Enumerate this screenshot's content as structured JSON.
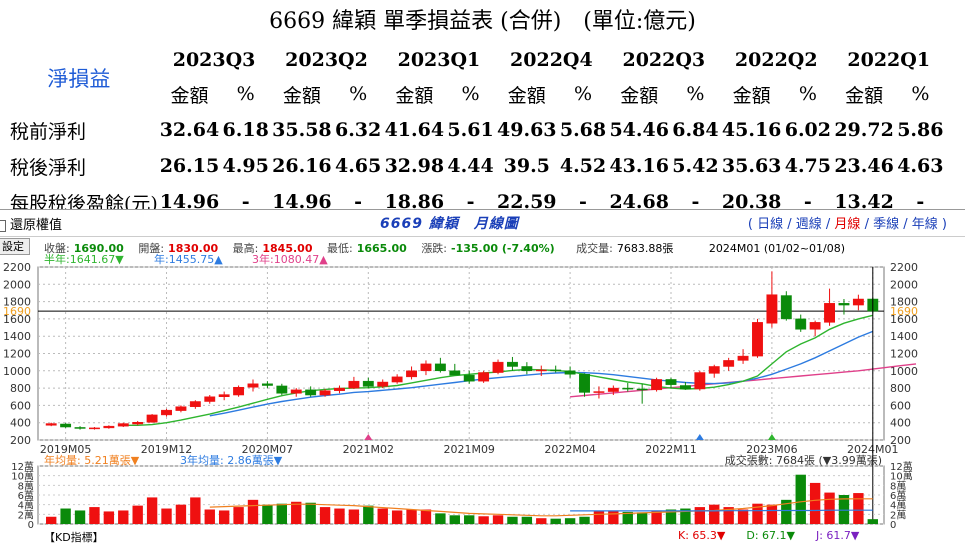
{
  "title": "6669 緯穎 單季損益表 (合併)　(單位:億元)",
  "table": {
    "net_label": "淨損益",
    "quarters": [
      "2023Q3",
      "2023Q2",
      "2023Q1",
      "2022Q4",
      "2022Q3",
      "2022Q2",
      "2022Q1"
    ],
    "amount_label": "金額",
    "pct_label": "%",
    "rows": [
      {
        "label": "稅前淨利",
        "cells": [
          [
            "32.64",
            "6.18"
          ],
          [
            "35.58",
            "6.32"
          ],
          [
            "41.64",
            "5.61"
          ],
          [
            "49.63",
            "5.68"
          ],
          [
            "54.46",
            "6.84"
          ],
          [
            "45.16",
            "6.02"
          ],
          [
            "29.72",
            "5.86"
          ]
        ]
      },
      {
        "label": "稅後淨利",
        "cells": [
          [
            "26.15",
            "4.95"
          ],
          [
            "26.16",
            "4.65"
          ],
          [
            "32.98",
            "4.44"
          ],
          [
            "39.5",
            "4.52"
          ],
          [
            "43.16",
            "5.42"
          ],
          [
            "35.63",
            "4.75"
          ],
          [
            "23.46",
            "4.63"
          ]
        ]
      },
      {
        "label": "每股稅後盈餘(元)",
        "cells": [
          [
            "14.96",
            "-"
          ],
          [
            "14.96",
            "-"
          ],
          [
            "18.86",
            "-"
          ],
          [
            "22.59",
            "-"
          ],
          [
            "24.68",
            "-"
          ],
          [
            "20.38",
            "-"
          ],
          [
            "13.42",
            "-"
          ]
        ]
      }
    ]
  },
  "chart_header": {
    "restore_label": "還原權值",
    "chart_name": "6669 緯穎　月線圖",
    "periods": [
      "日線",
      "週線",
      "月線",
      "季線",
      "年線"
    ],
    "active_period": "月線"
  },
  "quote": {
    "settings_label": "設定",
    "close_label": "收盤:",
    "close": "1690.00",
    "open_label": "開盤:",
    "open": "1830.00",
    "high_label": "最高:",
    "high": "1845.00",
    "low_label": "最低:",
    "low": "1665.00",
    "change_label": "漲跌:",
    "change": "-135.00 (-7.40%)",
    "volume_label": "成交量:",
    "volume": "7683.88張",
    "period_range": "2024M01 (01/02~01/08)"
  },
  "ma_legend": {
    "half_year": "半年:1641.67▼",
    "year": "年:1455.75▲",
    "three_year": "3年:1080.47▲"
  },
  "volume_legend": {
    "year_avg": "年均量: 5.21萬張▼",
    "three_year_avg": "3年均量: 2.86萬張▼",
    "count": "成交張數: 7684張 (▼3.99萬張)"
  },
  "kd": {
    "label": "【KD指標】",
    "k": "K: 65.3▼",
    "d": "D: 67.1▼",
    "j": "J: 61.7▼"
  },
  "colors": {
    "up": "#ef1010",
    "down": "#0a8a0a",
    "ma_half": "#2fb52f",
    "ma_year": "#2d7be0",
    "ma_3year": "#e0408a",
    "link": "#1a3fb8",
    "price_line": "#f0a020"
  },
  "chart_data": {
    "type": "candlestick",
    "y_ticks": [
      200,
      400,
      600,
      800,
      1000,
      1200,
      1400,
      1600,
      1800,
      2000,
      2200
    ],
    "ylim": [
      200,
      2200
    ],
    "price_marker": "1690",
    "x_tick_labels": [
      {
        "i": 1,
        "label": "2019M05"
      },
      {
        "i": 8,
        "label": "2019M12"
      },
      {
        "i": 15,
        "label": "2020M07"
      },
      {
        "i": 22,
        "label": "2021M02"
      },
      {
        "i": 29,
        "label": "2021M09"
      },
      {
        "i": 36,
        "label": "2022M04"
      },
      {
        "i": 43,
        "label": "2022M11"
      },
      {
        "i": 50,
        "label": "2023M06"
      },
      {
        "i": 57,
        "label": "2024M01"
      }
    ],
    "event_markers": [
      {
        "i": 22,
        "color": "#e0408a"
      },
      {
        "i": 45,
        "color": "#2d7be0"
      },
      {
        "i": 50,
        "color": "#2fb52f"
      }
    ],
    "ohlc": [
      [
        370,
        400,
        360,
        390
      ],
      [
        385,
        395,
        340,
        350
      ],
      [
        345,
        360,
        320,
        335
      ],
      [
        335,
        350,
        320,
        340
      ],
      [
        340,
        370,
        330,
        360
      ],
      [
        360,
        400,
        350,
        390
      ],
      [
        385,
        420,
        370,
        405
      ],
      [
        405,
        500,
        400,
        490
      ],
      [
        490,
        560,
        470,
        545
      ],
      [
        540,
        600,
        520,
        585
      ],
      [
        585,
        660,
        560,
        645
      ],
      [
        645,
        720,
        620,
        700
      ],
      [
        700,
        760,
        660,
        725
      ],
      [
        720,
        830,
        700,
        810
      ],
      [
        810,
        900,
        760,
        850
      ],
      [
        850,
        880,
        800,
        830
      ],
      [
        825,
        850,
        720,
        740
      ],
      [
        740,
        800,
        700,
        780
      ],
      [
        780,
        820,
        700,
        720
      ],
      [
        720,
        790,
        700,
        770
      ],
      [
        770,
        830,
        740,
        800
      ],
      [
        800,
        930,
        790,
        880
      ],
      [
        880,
        920,
        800,
        820
      ],
      [
        820,
        900,
        800,
        870
      ],
      [
        870,
        960,
        850,
        930
      ],
      [
        930,
        1050,
        900,
        1000
      ],
      [
        1000,
        1120,
        950,
        1080
      ],
      [
        1080,
        1150,
        980,
        1000
      ],
      [
        1000,
        1080,
        950,
        950
      ],
      [
        950,
        1000,
        850,
        880
      ],
      [
        880,
        1000,
        860,
        980
      ],
      [
        980,
        1130,
        960,
        1100
      ],
      [
        1100,
        1160,
        1000,
        1050
      ],
      [
        1050,
        1100,
        960,
        1000
      ],
      [
        1000,
        1060,
        940,
        1010
      ],
      [
        1010,
        1060,
        980,
        1000
      ],
      [
        1000,
        1050,
        920,
        960
      ],
      [
        960,
        970,
        700,
        750
      ],
      [
        750,
        820,
        680,
        760
      ],
      [
        760,
        830,
        720,
        800
      ],
      [
        800,
        860,
        760,
        790
      ],
      [
        790,
        850,
        620,
        780
      ],
      [
        780,
        920,
        760,
        900
      ],
      [
        900,
        920,
        800,
        840
      ],
      [
        830,
        870,
        780,
        790
      ],
      [
        790,
        1000,
        770,
        980
      ],
      [
        970,
        1070,
        920,
        1050
      ],
      [
        1050,
        1150,
        1000,
        1120
      ],
      [
        1120,
        1250,
        1080,
        1170
      ],
      [
        1170,
        1600,
        1150,
        1560
      ],
      [
        1550,
        2150,
        1500,
        1880
      ],
      [
        1870,
        1920,
        1580,
        1600
      ],
      [
        1600,
        1650,
        1450,
        1480
      ],
      [
        1480,
        1580,
        1400,
        1560
      ],
      [
        1560,
        1950,
        1520,
        1780
      ],
      [
        1780,
        1830,
        1650,
        1760
      ],
      [
        1760,
        1880,
        1700,
        1830
      ],
      [
        1830,
        1845,
        1665,
        1690
      ]
    ],
    "ma_half": [
      null,
      null,
      null,
      null,
      null,
      370,
      370,
      378,
      400,
      430,
      465,
      500,
      540,
      580,
      625,
      670,
      712,
      745,
      770,
      785,
      795,
      800,
      805,
      815,
      830,
      860,
      890,
      920,
      945,
      960,
      975,
      985,
      1005,
      1015,
      1012,
      1005,
      990,
      960,
      930,
      900,
      870,
      850,
      820,
      800,
      790,
      795,
      810,
      840,
      880,
      940,
      1080,
      1220,
      1310,
      1380,
      1480,
      1550,
      1600,
      1641.67
    ],
    "ma_year": [
      null,
      null,
      null,
      null,
      null,
      null,
      null,
      null,
      null,
      null,
      null,
      480,
      510,
      545,
      580,
      615,
      645,
      670,
      695,
      715,
      730,
      750,
      760,
      775,
      790,
      805,
      825,
      845,
      865,
      885,
      905,
      920,
      935,
      950,
      965,
      975,
      980,
      978,
      970,
      955,
      935,
      915,
      895,
      880,
      865,
      855,
      852,
      860,
      880,
      915,
      960,
      1020,
      1080,
      1150,
      1230,
      1310,
      1390,
      1455.75
    ],
    "ma_3year": [
      null,
      null,
      null,
      null,
      null,
      null,
      null,
      null,
      null,
      null,
      null,
      null,
      null,
      null,
      null,
      null,
      null,
      null,
      null,
      null,
      null,
      null,
      null,
      null,
      null,
      null,
      null,
      null,
      null,
      null,
      null,
      null,
      null,
      null,
      null,
      null,
      null,
      null,
      null,
      null,
      null,
      null,
      null,
      null,
      null,
      null,
      null,
      null,
      null,
      null,
      null,
      null,
      null,
      null,
      null,
      null,
      null,
      null,
      null,
      null,
      null,
      null,
      null,
      null,
      null,
      null,
      null,
      null,
      null,
      null,
      null,
      null,
      null,
      null,
      null,
      null,
      null,
      null,
      null,
      null,
      null,
      null,
      null,
      null,
      null,
      null,
      null,
      null,
      null,
      null,
      null,
      null,
      null,
      null
    ],
    "ma_3year_from": 36,
    "ma_3year_values": [
      700,
      715,
      730,
      745,
      760,
      775,
      790,
      805,
      820,
      835,
      850,
      865,
      880,
      895,
      910,
      925,
      940,
      955,
      970,
      985,
      1000,
      1020,
      1040,
      1060,
      1080
    ],
    "ma_3year_start_index": 36,
    "volume_ticks": [
      0,
      2,
      4,
      6,
      8,
      10,
      12
    ],
    "volume_unit": "萬",
    "volume_ylim": [
      0,
      12
    ],
    "volume": [
      1.5,
      3.2,
      2.8,
      3.5,
      2.6,
      2.8,
      3.8,
      5.5,
      3.2,
      4.0,
      5.5,
      3.0,
      2.8,
      3.5,
      5.0,
      4.0,
      4.2,
      4.6,
      4.4,
      3.5,
      3.2,
      3.0,
      3.8,
      3.2,
      2.8,
      3.0,
      3.0,
      2.2,
      1.8,
      1.8,
      1.6,
      1.8,
      1.5,
      1.5,
      1.2,
      1.1,
      1.2,
      1.5,
      2.6,
      2.8,
      2.5,
      2.4,
      2.8,
      3.0,
      3.2,
      3.5,
      4.0,
      3.5,
      3.0,
      4.2,
      4.0,
      5.0,
      10.2,
      8.5,
      6.5,
      6.0,
      6.4,
      1.0
    ],
    "volume_year_avg": [
      null,
      null,
      null,
      null,
      null,
      null,
      null,
      null,
      null,
      null,
      null,
      3.5,
      3.6,
      3.7,
      3.8,
      3.9,
      4.0,
      4.1,
      4.1,
      4.0,
      3.9,
      3.8,
      3.6,
      3.4,
      3.2,
      3.0,
      2.8,
      2.6,
      2.4,
      2.2,
      2.1,
      2.0,
      1.9,
      1.8,
      1.7,
      1.7,
      1.8,
      1.9,
      2.0,
      2.1,
      2.2,
      2.3,
      2.4,
      2.5,
      2.6,
      2.7,
      2.8,
      3.0,
      3.2,
      3.5,
      3.8,
      4.2,
      4.6,
      4.9,
      5.1,
      5.2,
      5.21,
      5.21
    ],
    "volume_3year_avg": [
      null,
      null,
      null,
      null,
      null,
      null,
      null,
      null,
      null,
      null,
      null,
      null,
      null,
      null,
      null,
      null,
      null,
      null,
      null,
      null,
      null,
      null,
      null,
      null,
      null,
      null,
      null,
      null,
      null,
      null,
      null,
      null,
      null,
      null,
      null,
      null,
      2.7,
      2.7,
      2.7,
      2.7,
      2.7,
      2.7,
      2.7,
      2.7,
      2.7,
      2.7,
      2.7,
      2.75,
      2.75,
      2.75,
      2.8,
      2.8,
      2.8,
      2.8,
      2.85,
      2.85,
      2.86,
      2.86
    ]
  }
}
